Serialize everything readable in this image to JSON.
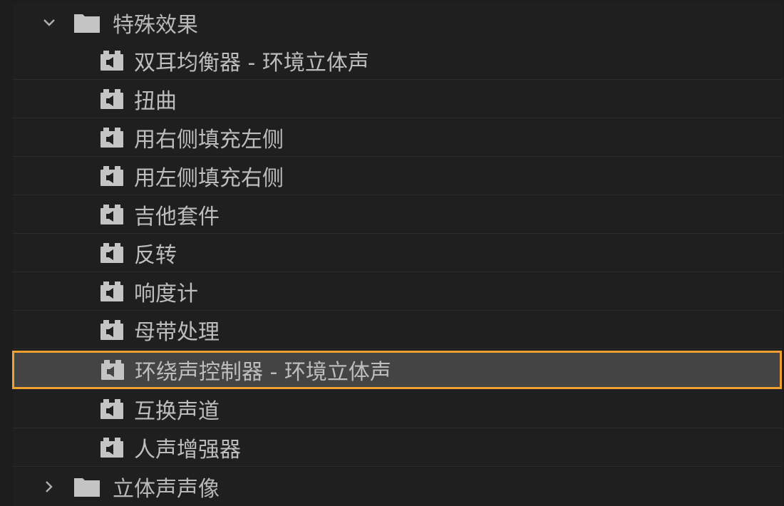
{
  "tree": {
    "groups": [
      {
        "label": "特殊效果",
        "expanded": true,
        "icon": "folder-icon",
        "children": [
          {
            "label": " 双耳均衡器 - 环境立体声",
            "icon": "audio-effect-icon"
          },
          {
            "label": "扭曲",
            "icon": "audio-effect-icon"
          },
          {
            "label": "用右侧填充左侧",
            "icon": "audio-effect-icon"
          },
          {
            "label": "用左侧填充右侧",
            "icon": "audio-effect-icon"
          },
          {
            "label": "吉他套件",
            "icon": "audio-effect-icon"
          },
          {
            "label": "反转",
            "icon": "audio-effect-icon"
          },
          {
            "label": "响度计",
            "icon": "audio-effect-icon"
          },
          {
            "label": "母带处理",
            "icon": "audio-effect-icon"
          },
          {
            "label": "环绕声控制器 - 环境立体声",
            "icon": "audio-effect-icon",
            "selected": true
          },
          {
            "label": "互换声道",
            "icon": "audio-effect-icon"
          },
          {
            "label": "人声增强器",
            "icon": "audio-effect-icon"
          }
        ]
      },
      {
        "label": "立体声声像",
        "expanded": false,
        "icon": "folder-icon"
      }
    ]
  },
  "colors": {
    "background": "#1d1d1d",
    "row": "#1f1f1f",
    "selected_row": "#444444",
    "selection_border": "#f0a030",
    "text": "#bdbdbd",
    "icon": "#c4c4c4"
  }
}
